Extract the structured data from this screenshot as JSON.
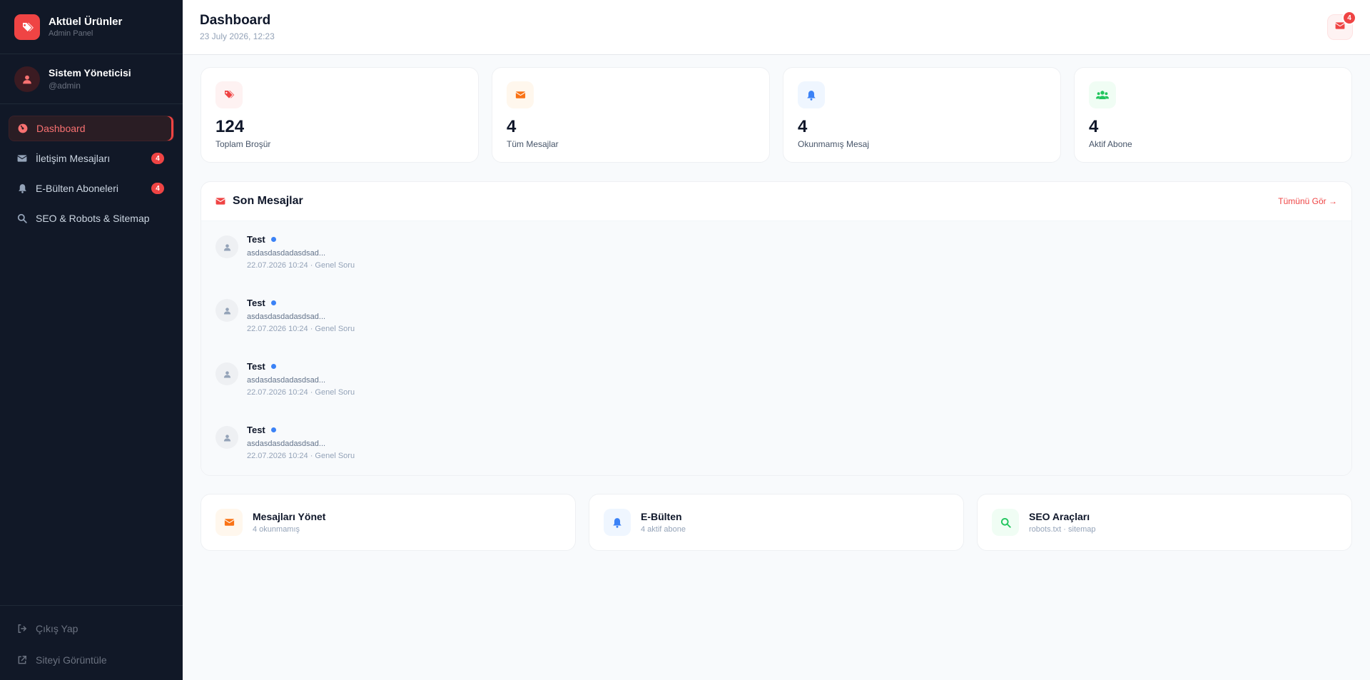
{
  "brand": {
    "title": "Aktüel Ürünler",
    "subtitle": "Admin Panel",
    "accent": "#ef4444"
  },
  "user": {
    "name": "Sistem Yöneticisi",
    "handle": "@admin"
  },
  "nav": {
    "items": [
      {
        "label": "Dashboard",
        "icon": "dashboard-icon",
        "active": true
      },
      {
        "label": "İletişim Mesajları",
        "icon": "envelope-icon",
        "badge": "4"
      },
      {
        "label": "E-Bülten Aboneleri",
        "icon": "bell-icon",
        "badge": "4"
      },
      {
        "label": "SEO & Robots & Sitemap",
        "icon": "search-icon"
      }
    ],
    "bottom": [
      {
        "label": "Çıkış Yap",
        "icon": "logout-icon"
      },
      {
        "label": "Siteyi Görüntüle",
        "icon": "external-link-icon"
      }
    ]
  },
  "header": {
    "title": "Dashboard",
    "date": "23 July 2026, 12:23",
    "mail_badge": "4"
  },
  "stats": [
    {
      "value": "124",
      "label": "Toplam Broşür",
      "icon": "tags-icon",
      "color": "#ef4444"
    },
    {
      "value": "4",
      "label": "Tüm Mesajlar",
      "icon": "envelope-icon",
      "color": "#f97316"
    },
    {
      "value": "4",
      "label": "Okunmamış Mesaj",
      "icon": "bell-icon",
      "color": "#3b82f6"
    },
    {
      "value": "4",
      "label": "Aktif Abone",
      "icon": "users-icon",
      "color": "#22c55e"
    }
  ],
  "messages": {
    "title": "Son Mesajlar",
    "see_all": "Tümünü Gör →",
    "items": [
      {
        "name": "Test",
        "preview": "asdasdasdadasdsad...",
        "meta": "22.07.2026 10:24 · Genel Soru"
      },
      {
        "name": "Test",
        "preview": "asdasdasdadasdsad...",
        "meta": "22.07.2026 10:24 · Genel Soru"
      },
      {
        "name": "Test",
        "preview": "asdasdasdadasdsad...",
        "meta": "22.07.2026 10:24 · Genel Soru"
      },
      {
        "name": "Test",
        "preview": "asdasdasdadasdsad...",
        "meta": "22.07.2026 10:24 · Genel Soru"
      }
    ]
  },
  "actions": [
    {
      "title": "Mesajları Yönet",
      "sub": "4 okunmamış",
      "icon": "envelope-icon",
      "color": "#f97316"
    },
    {
      "title": "E-Bülten",
      "sub": "4 aktif abone",
      "icon": "bell-icon",
      "color": "#3b82f6"
    },
    {
      "title": "SEO Araçları",
      "sub": "robots.txt · sitemap",
      "icon": "search-icon",
      "color": "#22c55e"
    }
  ]
}
